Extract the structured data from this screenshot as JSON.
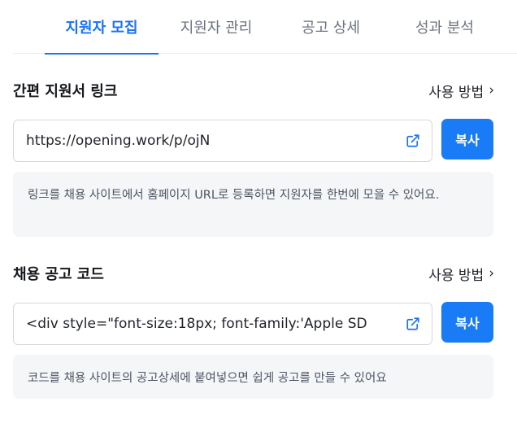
{
  "tabs": [
    {
      "label": "지원자 모집",
      "active": true
    },
    {
      "label": "지원자 관리",
      "active": false
    },
    {
      "label": "공고 상세",
      "active": false
    },
    {
      "label": "성과 분석",
      "active": false
    }
  ],
  "link_section": {
    "title": "간편 지원서 링크",
    "howto_label": "사용 방법",
    "howto_icon": "chevron-right-icon",
    "value": "https://opening.work/p/ojN",
    "open_icon": "external-link-icon",
    "copy_label": "복사",
    "note": "링크를 채용 사이트에서 홈페이지 URL로 등록하면 지원자를 한번에 모을 수 있어요."
  },
  "code_section": {
    "title": "채용 공고 코드",
    "howto_label": "사용 방법",
    "howto_icon": "chevron-right-icon",
    "value": "<div style=\"font-size:18px; font-family:'Apple SD",
    "open_icon": "external-link-icon",
    "copy_label": "복사",
    "note": "코드를 채용 사이트의 공고상세에 붙여넣으면 쉽게 공고를 만들 수 있어요"
  },
  "colors": {
    "accent": "#1a73f5",
    "button": "#1a7bf7",
    "note_bg": "#f4f6f8"
  }
}
